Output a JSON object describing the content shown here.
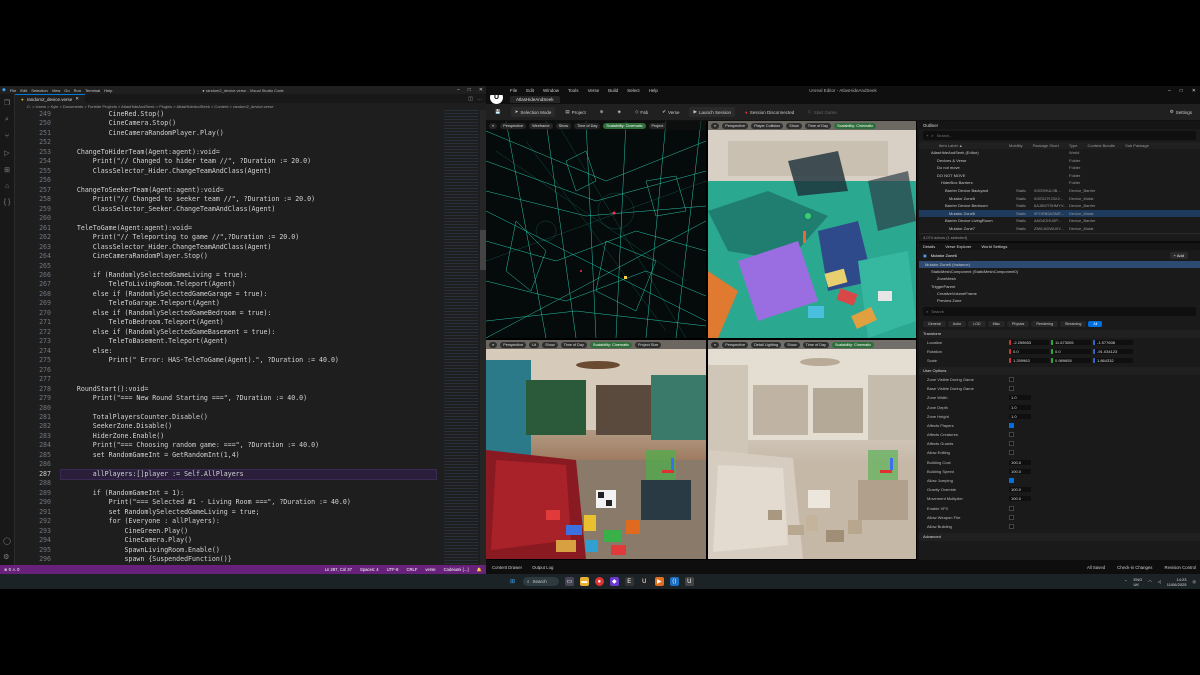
{
  "vscode": {
    "window_title": "● random2_device.verse - Visual Studio Code",
    "menu": [
      "File",
      "Edit",
      "Selection",
      "View",
      "Go",
      "Run",
      "Terminal",
      "Help"
    ],
    "tab_label": "random2_device.verse",
    "breadcrumb": "C: > Users > Kyle > Documents > Fortnite Projects > AtlasHideAndSeek > Plugins > AtlasHideAndSeek > Content > random2_device.verse",
    "current_line": 287,
    "lines": [
      {
        "n": 249,
        "t": "            CineRed.Stop()"
      },
      {
        "n": 250,
        "t": "            CineCamera.Stop()"
      },
      {
        "n": 251,
        "t": "            CineCameraRandomPlayer.Play()"
      },
      {
        "n": 252,
        "t": ""
      },
      {
        "n": 253,
        "t": "    ChangeToHiderTeam(Agent:agent):void="
      },
      {
        "n": 254,
        "t": "        Print(\"// Changed to hider team //\", ?Duration := 20.0)"
      },
      {
        "n": 255,
        "t": "        ClassSelector_Hider.ChangeTeamAndClass(Agent)"
      },
      {
        "n": 256,
        "t": ""
      },
      {
        "n": 257,
        "t": "    ChangeToSeekerTeam(Agent:agent):void="
      },
      {
        "n": 258,
        "t": "        Print(\"// Changed to seeker team //\", ?Duration := 20.0)"
      },
      {
        "n": 259,
        "t": "        ClassSelector_Seeker.ChangeTeamAndClass(Agent)"
      },
      {
        "n": 260,
        "t": ""
      },
      {
        "n": 261,
        "t": "    TeleToGame(Agent:agent):void="
      },
      {
        "n": 262,
        "t": "        Print(\"// Teleporting to game //\",?Duration := 20.0)"
      },
      {
        "n": 263,
        "t": "        ClassSelector_Hider.ChangeTeamAndClass(Agent)"
      },
      {
        "n": 264,
        "t": "        CineCameraRandomPlayer.Stop()"
      },
      {
        "n": 265,
        "t": ""
      },
      {
        "n": 266,
        "t": "        if (RandomlySelectedGameLiving = true):"
      },
      {
        "n": 267,
        "t": "            TeleToLivingRoom.Teleport(Agent)"
      },
      {
        "n": 268,
        "t": "        else if (RandomlySelectedGameGarage = true):"
      },
      {
        "n": 269,
        "t": "            TeleToGarage.Teleport(Agent)"
      },
      {
        "n": 270,
        "t": "        else if (RandomlySelectedGameBedroom = true):"
      },
      {
        "n": 271,
        "t": "            TeleToBedroom.Teleport(Agent)"
      },
      {
        "n": 272,
        "t": "        else if (RandomlySelectedGameBasement = true):"
      },
      {
        "n": 273,
        "t": "            TeleToBasement.Teleport(Agent)"
      },
      {
        "n": 274,
        "t": "        else:"
      },
      {
        "n": 275,
        "t": "            Print(\" Error: HAS-TeleToGame(Agent).\", ?Duration := 40.0)"
      },
      {
        "n": 276,
        "t": ""
      },
      {
        "n": 277,
        "t": ""
      },
      {
        "n": 278,
        "t": "    RoundStart():void="
      },
      {
        "n": 279,
        "t": "        Print(\"=== New Round Starting ===\", ?Duration := 40.0)"
      },
      {
        "n": 280,
        "t": ""
      },
      {
        "n": 281,
        "t": "        TotalPlayersCounter.Disable()"
      },
      {
        "n": 282,
        "t": "        SeekerZone.Disable()"
      },
      {
        "n": 283,
        "t": "        HiderZone.Enable()"
      },
      {
        "n": 284,
        "t": "        Print(\"=== Choosing random game: ===\", ?Duration := 40.0)"
      },
      {
        "n": 285,
        "t": "        set RandomGameInt = GetRandomInt(1,4)"
      },
      {
        "n": 286,
        "t": ""
      },
      {
        "n": 287,
        "t": "        allPlayers:[]player := Self.AllPlayers"
      },
      {
        "n": 288,
        "t": ""
      },
      {
        "n": 289,
        "t": "        if (RandomGameInt = 1):"
      },
      {
        "n": 290,
        "t": "            Print(\"=== Selected #1 - Living Room ===\", ?Duration := 40.0)"
      },
      {
        "n": 291,
        "t": "            set RandomlySelectedGameLiving = true;"
      },
      {
        "n": 292,
        "t": "            for (Everyone : allPlayers):"
      },
      {
        "n": 293,
        "t": "                CineGreen.Play()"
      },
      {
        "n": 294,
        "t": "                CineCamera.Play()"
      },
      {
        "n": 295,
        "t": "                SpawnLivingRoom.Enable()"
      },
      {
        "n": 296,
        "t": "                spawn {SuspendedFunction()}"
      }
    ],
    "status_left": "⊗ 0 ⚠ 0",
    "status_right": [
      "Ln 287, Col 37",
      "Spaces: 4",
      "UTF-8",
      "CRLF",
      "verse",
      "Codeiumi {...}",
      "🔔"
    ]
  },
  "unreal": {
    "window_title": "Unreal Editor - AtlasHideAndSeek",
    "menu": [
      "File",
      "Edit",
      "Window",
      "Tools",
      "Verse",
      "Build",
      "Select",
      "Help"
    ],
    "project_tab": "AtlasHideAndSeek",
    "toolbar": {
      "selection_mode": "Selection Mode",
      "project": "Project",
      "fab": "Fab",
      "verse": "Verse",
      "launch_session": "Launch Session",
      "session_status": "Session Disconnected",
      "start_game": "Start Game",
      "settings": "Settings"
    },
    "viewports": [
      {
        "mode": "Perspective",
        "shading": "Wireframe",
        "show": "Show",
        "tod": "Time of Day",
        "scal": "Scalability: Cinematic",
        "extra": "Project"
      },
      {
        "mode": "Perspective",
        "shading": "Player Collision",
        "show": "Show",
        "tod": "Time of Day",
        "scal": "Scalability: Cinematic",
        "extra": ""
      },
      {
        "mode": "Perspective",
        "shading": "Lit",
        "show": "Show",
        "tod": "Time of Day",
        "scal": "Scalability: Cinematic",
        "extra": "Project Size"
      },
      {
        "mode": "Perspective",
        "shading": "Detail Lighting",
        "show": "Show",
        "tod": "Time of Day",
        "scal": "Scalability: Cinematic",
        "extra": ""
      }
    ],
    "outliner": {
      "title": "Outliner",
      "search_placeholder": "Search...",
      "columns": [
        "Item Label ▲",
        "Mobility",
        "Package Short",
        "Type",
        "Content Bundle",
        "Sub Package"
      ],
      "rows": [
        {
          "name": "AtlasHideAndSeek (Editor)",
          "mob": "",
          "pkg": "",
          "typ": "World",
          "sel": false
        },
        {
          "name": "Devices & Verse",
          "mob": "",
          "pkg": "",
          "typ": "Folder",
          "sel": false
        },
        {
          "name": "Do not move",
          "mob": "",
          "pkg": "",
          "typ": "Folder",
          "sel": false
        },
        {
          "name": "DO NOT MOVE",
          "mob": "",
          "pkg": "",
          "typ": "Folder",
          "sel": false
        },
        {
          "name": "HiderBox Barriers",
          "mob": "",
          "pkg": "",
          "typ": "Folder",
          "sel": false
        },
        {
          "name": "Barrier Device Backyard",
          "mob": "Static",
          "pkg": "0GD9HUL0B...",
          "typ": "Device_Barrier",
          "sel": false
        },
        {
          "name": "Mutator Zone5",
          "mob": "Static",
          "pkg": "0GE0ZIY23X2...",
          "typ": "Device_Mutat",
          "sel": false
        },
        {
          "name": "Barrier Device Bedroom",
          "mob": "Static",
          "pkg": "6AJ8WTSHMYV...",
          "typ": "Device_Barrier",
          "sel": false
        },
        {
          "name": "Mutator Zone6",
          "mob": "Static",
          "pkg": "9FORB6ASME...",
          "typ": "Device_Mutat",
          "sel": true
        },
        {
          "name": "Barrier Device LivingRoom",
          "mob": "Static",
          "pkg": "A6G4OHU5P...",
          "typ": "Device_Barrier",
          "sel": false
        },
        {
          "name": "Mutator Zone7",
          "mob": "Static",
          "pkg": "ZIWLNDWU0Y...",
          "typ": "Device_Mutat",
          "sel": false
        }
      ],
      "actor_count": "4,074 actors (1 selected)"
    },
    "details": {
      "tabs": [
        "Details",
        "Verse Explorer",
        "World Settings"
      ],
      "actor_name": "Mutator Zone6",
      "add_label": "+ Add",
      "components": [
        "Mutator Zone6 (Instance)",
        "StaticMeshComponent (StaticMeshComponent0)",
        "ZoneMesh",
        "TriggerParent",
        "CreativeVolumeFrame",
        "Preview Zone"
      ],
      "search_placeholder": "Search",
      "filters": [
        "General",
        "Actor",
        "LOD",
        "Misc",
        "Physics",
        "Rendering",
        "Streaming",
        "All"
      ],
      "transform_head": "Transform",
      "location_label": "Location",
      "location": [
        "-2.259653",
        "11.673005",
        "-1.577608"
      ],
      "rotation_label": "Rotation",
      "rotation": [
        "0.0",
        "0.0",
        "-91.034123"
      ],
      "scale_label": "Scale",
      "scale": [
        "1.259963",
        "0.989655",
        "1.864332"
      ],
      "user_options_head": "User Options",
      "options": [
        {
          "label": "Zone Visible During Game",
          "type": "chk",
          "on": false
        },
        {
          "label": "Base Visible During Game",
          "type": "chk",
          "on": false
        },
        {
          "label": "Zone Width",
          "type": "val",
          "value": "1.0"
        },
        {
          "label": "Zone Depth",
          "type": "val",
          "value": "1.0"
        },
        {
          "label": "Zone Height",
          "type": "val",
          "value": "1.0"
        },
        {
          "label": "Affects Players",
          "type": "chk",
          "on": true
        },
        {
          "label": "Affects Creatures",
          "type": "chk",
          "on": false
        },
        {
          "label": "Affects Guards",
          "type": "chk",
          "on": false
        },
        {
          "label": "Allow Editing",
          "type": "chk",
          "on": false
        },
        {
          "label": "Building Cost",
          "type": "val",
          "value": "100.0"
        },
        {
          "label": "Building Speed",
          "type": "val",
          "value": "100.0"
        },
        {
          "label": "Allow Jumping",
          "type": "chk",
          "on": true
        },
        {
          "label": "Gravity Override",
          "type": "val",
          "value": "100.0"
        },
        {
          "label": "Movement Multiplier",
          "type": "val",
          "value": "100.0"
        },
        {
          "label": "Enable VFX",
          "type": "chk",
          "on": false
        },
        {
          "label": "Allow Weapon Fire",
          "type": "chk",
          "on": false
        },
        {
          "label": "Allow Building",
          "type": "chk",
          "on": false
        }
      ],
      "advanced_head": "Advanced"
    },
    "statusbar": {
      "content_drawer": "Content Drawer",
      "output_log": "Output Log",
      "all_saved": "All Saved",
      "check_in": "Check-in Changes",
      "revision": "Revision Control"
    }
  },
  "taskbar": {
    "search_label": "Search",
    "lang": "ENG",
    "region": "UK",
    "time": "14:23",
    "date": "11/06/2025"
  },
  "colors": {
    "vscode_status": "#68217a",
    "ue_selection": "#0070e0",
    "wireframe_cyan": "#2ee6c8"
  }
}
